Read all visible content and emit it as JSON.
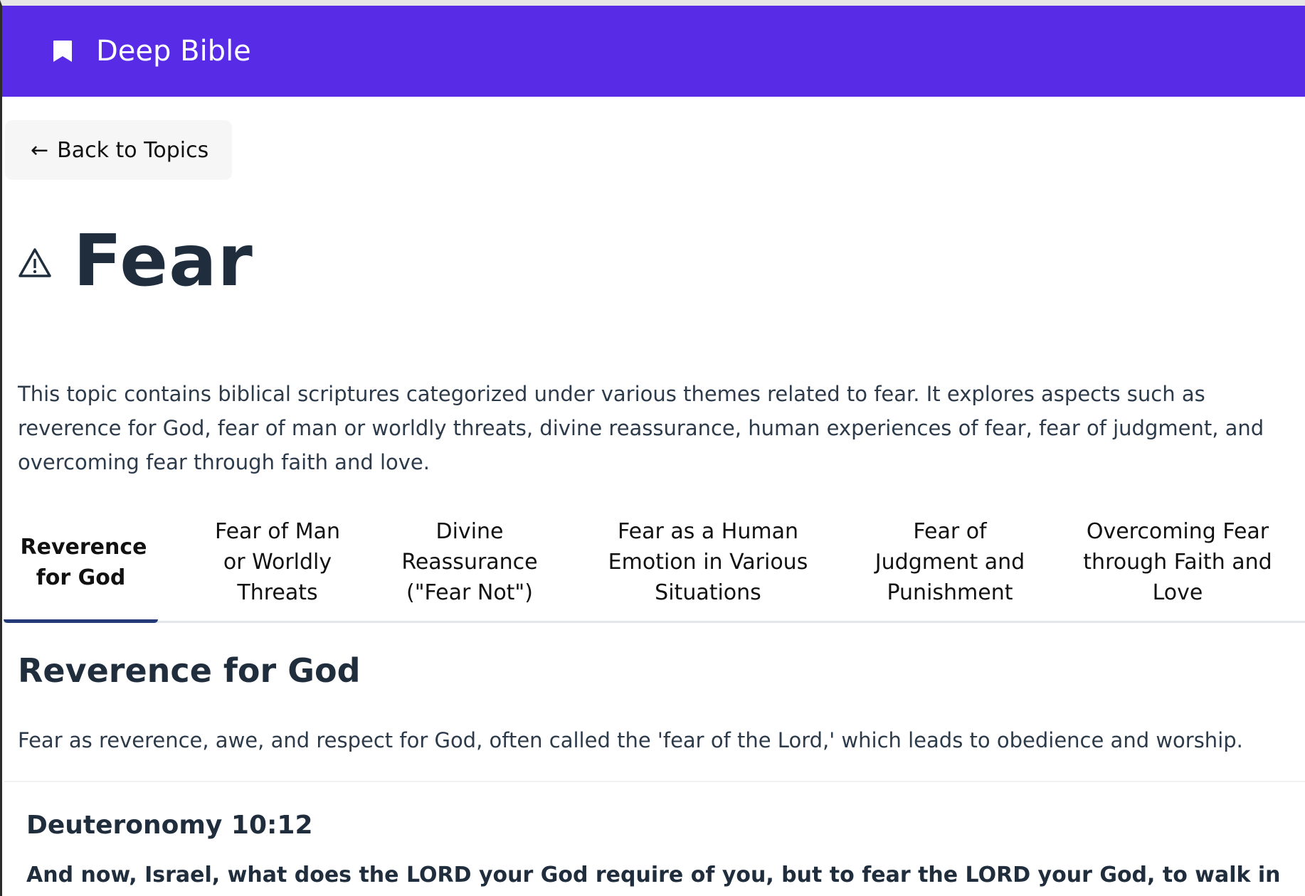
{
  "app": {
    "brand": "Deep Bible",
    "brand_icon": "bookmark-icon",
    "header_color": "#582be7"
  },
  "nav": {
    "back_label": "Back to Topics",
    "back_icon": "←"
  },
  "topic": {
    "icon": "warning-icon",
    "title": "Fear",
    "description": "This topic contains biblical scriptures categorized under various themes related to fear. It explores aspects such as reverence for God, fear of man or worldly threats, divine reassurance, human experiences of fear, fear of judgment, and overcoming fear through faith and love."
  },
  "tabs": [
    {
      "label": "Reverence for God",
      "active": true
    },
    {
      "label": "Fear of Man or Worldly Threats",
      "active": false
    },
    {
      "label": "Divine Reassurance (\"Fear Not\")",
      "active": false
    },
    {
      "label": "Fear as a Human Emotion in Various Situations",
      "active": false
    },
    {
      "label": "Fear of Judgment and Punishment",
      "active": false
    },
    {
      "label": "Overcoming Fear through Faith and Love",
      "active": false
    }
  ],
  "section": {
    "title": "Reverence for God",
    "description": "Fear as reverence, awe, and respect for God, often called the 'fear of the Lord,' which leads to obedience and worship."
  },
  "verses": [
    {
      "reference": "Deuteronomy 10:12",
      "text": "And now, Israel, what does the LORD your God require of you, but to fear the LORD your God, to walk in all his ways, and to love him, to serve the LORD your God with all your heart and with all your soul,"
    }
  ]
}
